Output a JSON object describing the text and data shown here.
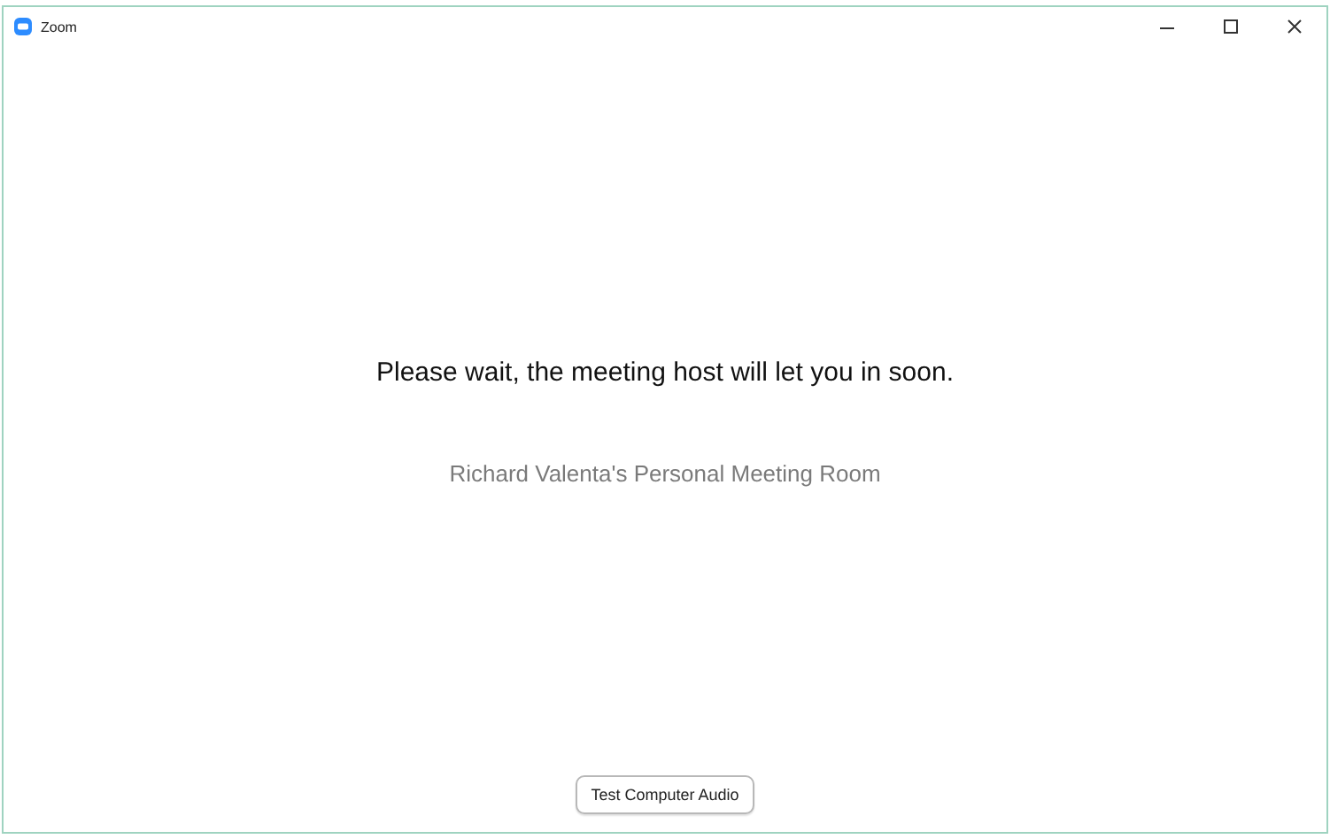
{
  "window": {
    "title": "Zoom"
  },
  "message": "Please wait, the meeting host will let you in soon.",
  "room": "Richard Valenta's Personal Meeting Room",
  "buttons": [
    "Test Computer Audio"
  ]
}
